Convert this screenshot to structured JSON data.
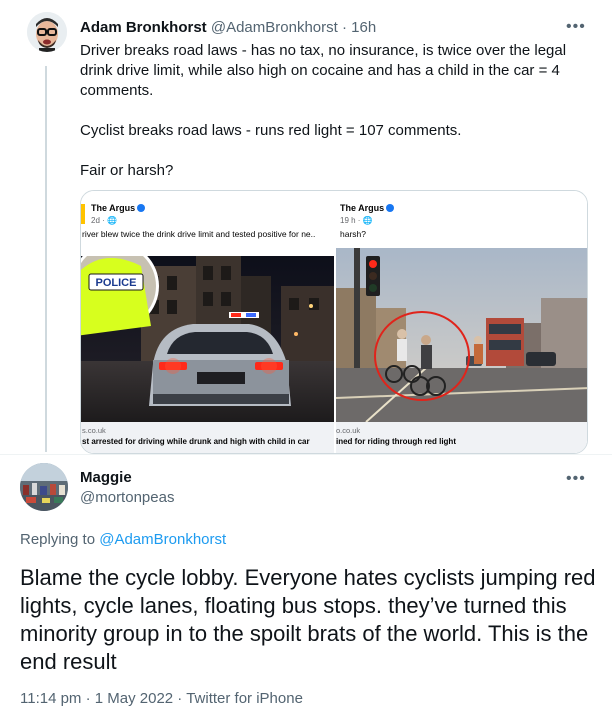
{
  "tweet1": {
    "name": "Adam Bronkhorst",
    "handle": "@AdamBronkhorst",
    "separator": "·",
    "time": "16h",
    "more": "•••",
    "paragraphs": [
      "Driver breaks road laws - has no tax, no insurance, is twice over the legal drink drive limit, while also high on cocaine and has a child in the car = 4 comments.",
      "Cyclist breaks road laws - runs red light = 107 comments.",
      "Fair or harsh?"
    ],
    "media": {
      "left": {
        "publisher": "The Argus",
        "meta": "2d · ",
        "text": "river blew twice the drink drive limit and tested positive for ne..",
        "police_sign": "POLICE",
        "domain": "s.co.uk",
        "caption": "st arrested for driving while drunk and high with child in car"
      },
      "right": {
        "publisher": "The Argus",
        "meta": "19 h · ",
        "text": "harsh?",
        "domain": "o.co.uk",
        "caption": "ined for riding through red light"
      }
    }
  },
  "tweet2": {
    "name": "Maggie",
    "handle": "@mortonpeas",
    "more": "•••",
    "replying_prefix": "Replying to ",
    "replying_mention": "@AdamBronkhorst",
    "body": "Blame the cycle lobby. Everyone hates cyclists jumping red lights, cycle lanes, floating bus stops. they’ve turned this minority group in to the spoilt brats of the world. This is the end result",
    "timestamp": "11:14 pm · 1 May 2022 · Twitter for iPhone"
  },
  "colors": {
    "text": "#0f1419",
    "secondary": "#536471",
    "link": "#1d9bf0",
    "border": "#cfd9de",
    "police_yellow": "#d7ff1e",
    "brake_red": "#ff2a1a",
    "circle_red": "#e0241b"
  },
  "icons": [
    "avatar-adam",
    "avatar-maggie",
    "more-icon",
    "verified-icon",
    "globe-icon"
  ]
}
